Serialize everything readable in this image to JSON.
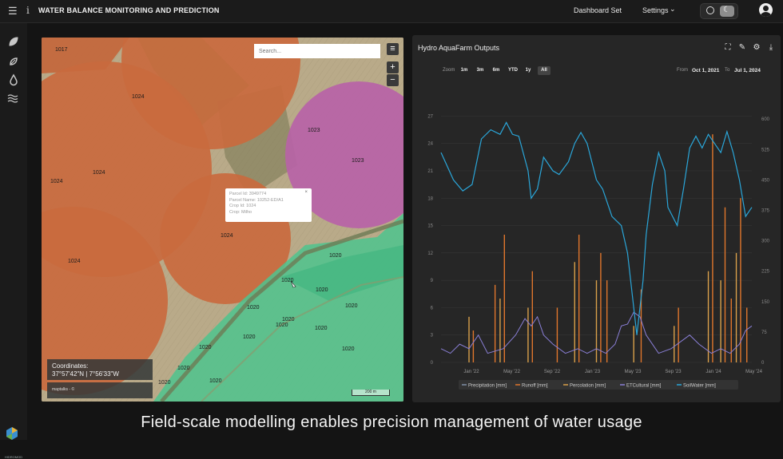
{
  "topbar": {
    "title": "WATER BALANCE MONITORING AND PREDICTION",
    "dashboard_set": "Dashboard Set",
    "settings": "Settings"
  },
  "map": {
    "search_placeholder": "Search...",
    "parcel_labels": [
      "1017",
      "1024",
      "1024",
      "1024",
      "1024",
      "1024",
      "1023",
      "1023",
      "1020",
      "1020",
      "1020",
      "1020",
      "1020",
      "1020",
      "1020",
      "1020",
      "1020",
      "1020",
      "1020",
      "1020",
      "1020",
      "1020"
    ],
    "popup": {
      "lines": [
        "Parcel Id: 3949774",
        "Parcel Name: 10252-ED/A1",
        "Crop Id: 1024",
        "Crop: Milho"
      ]
    },
    "coordinates_label": "Coordinates:",
    "coordinates_value": "37°57'42\"N | 7°56'33\"W",
    "attribution": "maptalks - ©",
    "scale": "200 m"
  },
  "chart": {
    "title": "Hydro AquaFarm Outputs",
    "zoom_label": "Zoom",
    "zoom_options": [
      "1m",
      "3m",
      "6m",
      "YTD",
      "1y",
      "All"
    ],
    "zoom_selected": "All",
    "from_label": "From",
    "from_value": "Oct 1, 2021",
    "to_label": "To",
    "to_value": "Jul 1, 2024"
  },
  "chart_data": {
    "type": "line",
    "x_ticks": [
      "Jan '22",
      "May '22",
      "Sep '22",
      "Jan '23",
      "May '23",
      "Sep '23",
      "Jan '24",
      "May '24"
    ],
    "y_left_ticks": [
      0,
      3,
      6,
      9,
      12,
      15,
      18,
      21,
      24,
      27
    ],
    "y_left_range": [
      0,
      28
    ],
    "y_right_ticks": [
      0,
      75,
      150,
      225,
      300,
      375,
      450,
      525,
      600
    ],
    "y_right_range": [
      0,
      630
    ],
    "legend": [
      "Precipitation [mm]",
      "Runoff [mm]",
      "Percolation [mm]",
      "ETCultural [mm]",
      "SoilWater [mm]"
    ],
    "colors": {
      "precipitation": "#7f8fa6",
      "runoff": "#e0762c",
      "percolation": "#d9a04a",
      "etcultural": "#8a7fd6",
      "soilwater": "#2aa6d9"
    },
    "soilwater": [
      [
        0,
        23
      ],
      [
        0.04,
        20
      ],
      [
        0.07,
        18.8
      ],
      [
        0.1,
        19.5
      ],
      [
        0.13,
        24.5
      ],
      [
        0.16,
        25.5
      ],
      [
        0.19,
        25
      ],
      [
        0.21,
        26.3
      ],
      [
        0.23,
        25
      ],
      [
        0.25,
        24.8
      ],
      [
        0.28,
        21
      ],
      [
        0.29,
        18
      ],
      [
        0.31,
        19
      ],
      [
        0.33,
        22.5
      ],
      [
        0.36,
        21
      ],
      [
        0.38,
        20.6
      ],
      [
        0.41,
        22
      ],
      [
        0.43,
        24
      ],
      [
        0.45,
        25.2
      ],
      [
        0.47,
        24
      ],
      [
        0.5,
        20
      ],
      [
        0.52,
        19
      ],
      [
        0.55,
        16
      ],
      [
        0.58,
        15
      ],
      [
        0.6,
        12
      ],
      [
        0.62,
        6
      ],
      [
        0.63,
        3
      ],
      [
        0.65,
        9
      ],
      [
        0.66,
        14
      ],
      [
        0.68,
        19.5
      ],
      [
        0.7,
        23
      ],
      [
        0.72,
        21
      ],
      [
        0.73,
        17
      ],
      [
        0.76,
        15
      ],
      [
        0.78,
        19
      ],
      [
        0.8,
        23.5
      ],
      [
        0.82,
        24.8
      ],
      [
        0.84,
        23.5
      ],
      [
        0.86,
        25
      ],
      [
        0.88,
        24
      ],
      [
        0.9,
        23
      ],
      [
        0.92,
        25.3
      ],
      [
        0.94,
        23
      ],
      [
        0.96,
        20
      ],
      [
        0.98,
        16
      ],
      [
        1.0,
        17
      ]
    ],
    "etcultural": [
      [
        0,
        1.5
      ],
      [
        0.03,
        1
      ],
      [
        0.06,
        2
      ],
      [
        0.09,
        1.5
      ],
      [
        0.12,
        3
      ],
      [
        0.15,
        1
      ],
      [
        0.2,
        1.5
      ],
      [
        0.24,
        3
      ],
      [
        0.27,
        4.8
      ],
      [
        0.29,
        4
      ],
      [
        0.31,
        5
      ],
      [
        0.33,
        3
      ],
      [
        0.36,
        2
      ],
      [
        0.4,
        1
      ],
      [
        0.44,
        1.5
      ],
      [
        0.47,
        1
      ],
      [
        0.5,
        1.5
      ],
      [
        0.53,
        1
      ],
      [
        0.56,
        2
      ],
      [
        0.58,
        4
      ],
      [
        0.6,
        4.2
      ],
      [
        0.62,
        5.5
      ],
      [
        0.64,
        5
      ],
      [
        0.66,
        3
      ],
      [
        0.7,
        1
      ],
      [
        0.74,
        1.5
      ],
      [
        0.78,
        2.5
      ],
      [
        0.8,
        3
      ],
      [
        0.83,
        2
      ],
      [
        0.87,
        1
      ],
      [
        0.9,
        1.5
      ],
      [
        0.93,
        1
      ],
      [
        0.96,
        2
      ],
      [
        0.98,
        3.5
      ],
      [
        1.0,
        4
      ]
    ],
    "runoff_spikes": [
      [
        0.1,
        3.5
      ],
      [
        0.17,
        8.5
      ],
      [
        0.2,
        14
      ],
      [
        0.29,
        10
      ],
      [
        0.37,
        6
      ],
      [
        0.44,
        14
      ],
      [
        0.51,
        12
      ],
      [
        0.53,
        9
      ],
      [
        0.64,
        8
      ],
      [
        0.76,
        6
      ],
      [
        0.87,
        25
      ],
      [
        0.91,
        17
      ],
      [
        0.93,
        7
      ],
      [
        0.96,
        18
      ],
      [
        0.98,
        6
      ]
    ],
    "percolation_spikes": [
      [
        0.09,
        5
      ],
      [
        0.19,
        7
      ],
      [
        0.28,
        6
      ],
      [
        0.43,
        11
      ],
      [
        0.5,
        9
      ],
      [
        0.62,
        4
      ],
      [
        0.75,
        4
      ],
      [
        0.86,
        10
      ],
      [
        0.9,
        9
      ],
      [
        0.95,
        12
      ]
    ]
  },
  "subtitle": "Field-scale modelling enables precision management of water usage",
  "logo_text": "HIDROMOD"
}
